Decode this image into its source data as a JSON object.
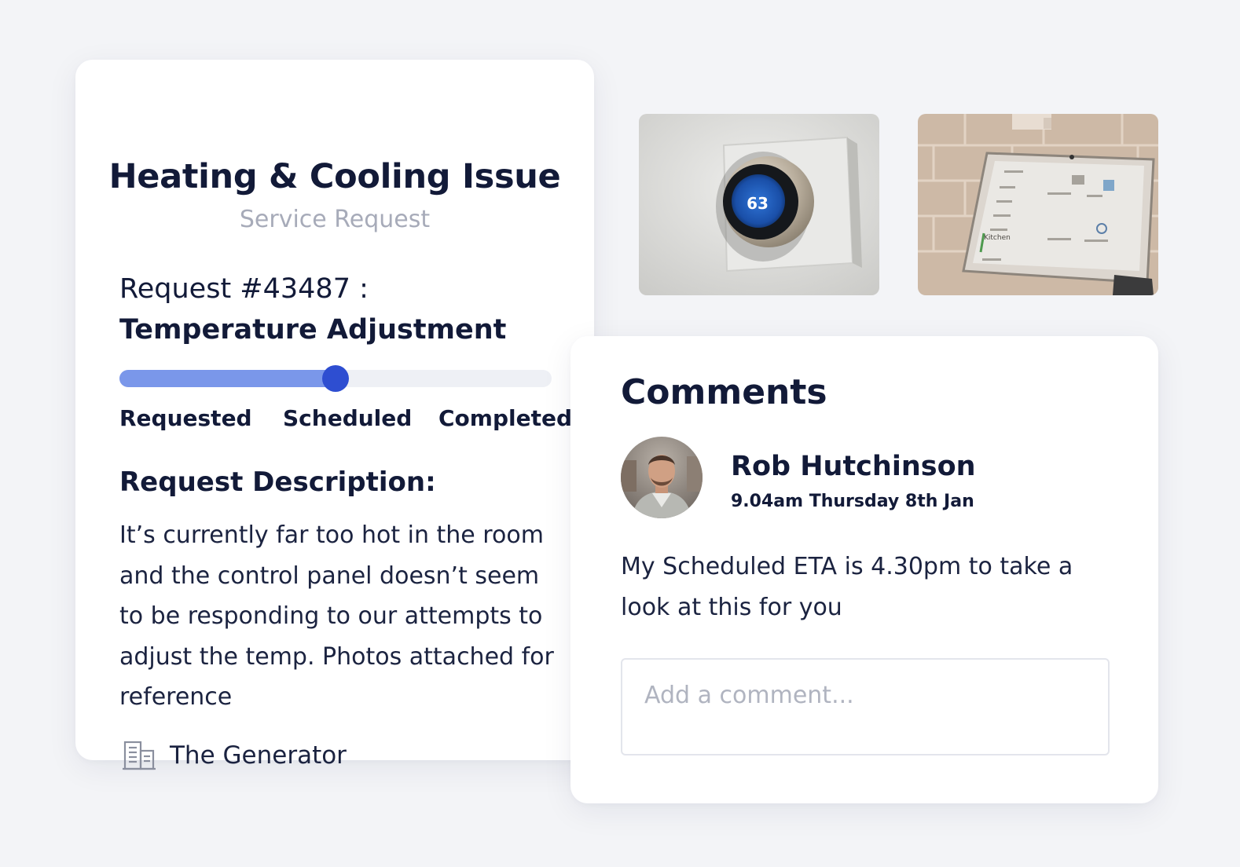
{
  "request": {
    "title": "Heating & Cooling Issue",
    "subtitle": "Service Request",
    "number_text": "Request #43487 : ",
    "type_text": "Temperature Adjustment",
    "progress": {
      "fraction": 0.5,
      "steps": [
        "Requested",
        "Scheduled",
        "Completed"
      ],
      "fill_color": "#7a97ea",
      "knob_color": "#2e4ed1"
    },
    "description_title": "Request Description:",
    "description": "It’s currently far too hot in the room and the control panel doesn’t seem to be responding to our attempts to adjust the temp. Photos attached for reference",
    "location": {
      "icon": "building-icon",
      "name": "The Generator"
    }
  },
  "photos": [
    {
      "name": "thermostat-photo",
      "display_value": "63"
    },
    {
      "name": "smart-display-photo",
      "display_label": "Kitchen"
    }
  ],
  "comments": {
    "title": "Comments",
    "items": [
      {
        "author": "Rob Hutchinson",
        "timestamp": "9.04am Thursday 8th Jan",
        "body": "My Scheduled ETA is 4.30pm to take a look at this for you"
      }
    ],
    "input": {
      "value": "",
      "placeholder": "Add a comment..."
    }
  },
  "colors": {
    "background": "#f3f4f7",
    "card": "#ffffff",
    "text_dark": "#121a38",
    "text_muted": "#a7abb9",
    "accent": "#2e4ed1"
  }
}
